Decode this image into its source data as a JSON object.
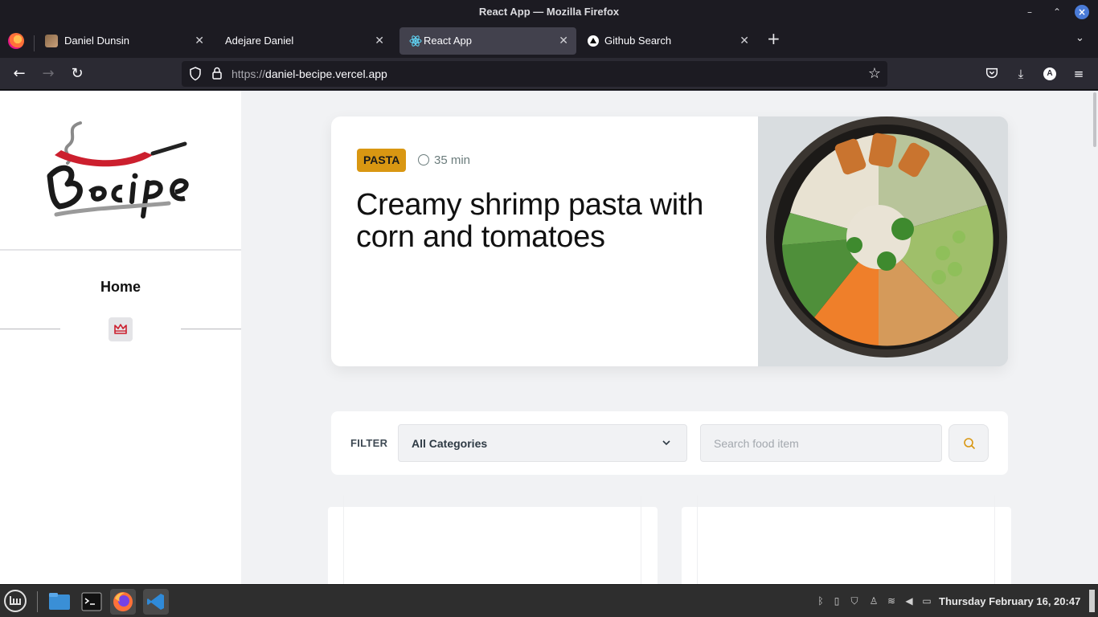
{
  "window": {
    "title": "React App — Mozilla Firefox"
  },
  "tabs": [
    {
      "label": "Daniel Dunsin"
    },
    {
      "label": "Adejare Daniel"
    },
    {
      "label": "React App"
    },
    {
      "label": "Github Search"
    }
  ],
  "address": {
    "scheme": "https://",
    "host": "daniel-becipe.vercel.app"
  },
  "account_initial": "A",
  "sidebar": {
    "nav_home": "Home"
  },
  "hero": {
    "category": "PASTA",
    "duration": "35 min",
    "title": "Creamy shrimp pasta with corn and tomatoes"
  },
  "filter": {
    "label": "FILTER",
    "category_selected": "All Categories",
    "search_placeholder": "Search food item"
  },
  "taskbar": {
    "datetime": "Thursday February 16, 20:47"
  },
  "colors": {
    "badge": "#d99712",
    "accent_red": "#cc1f2e",
    "search_icon": "#d99712"
  }
}
